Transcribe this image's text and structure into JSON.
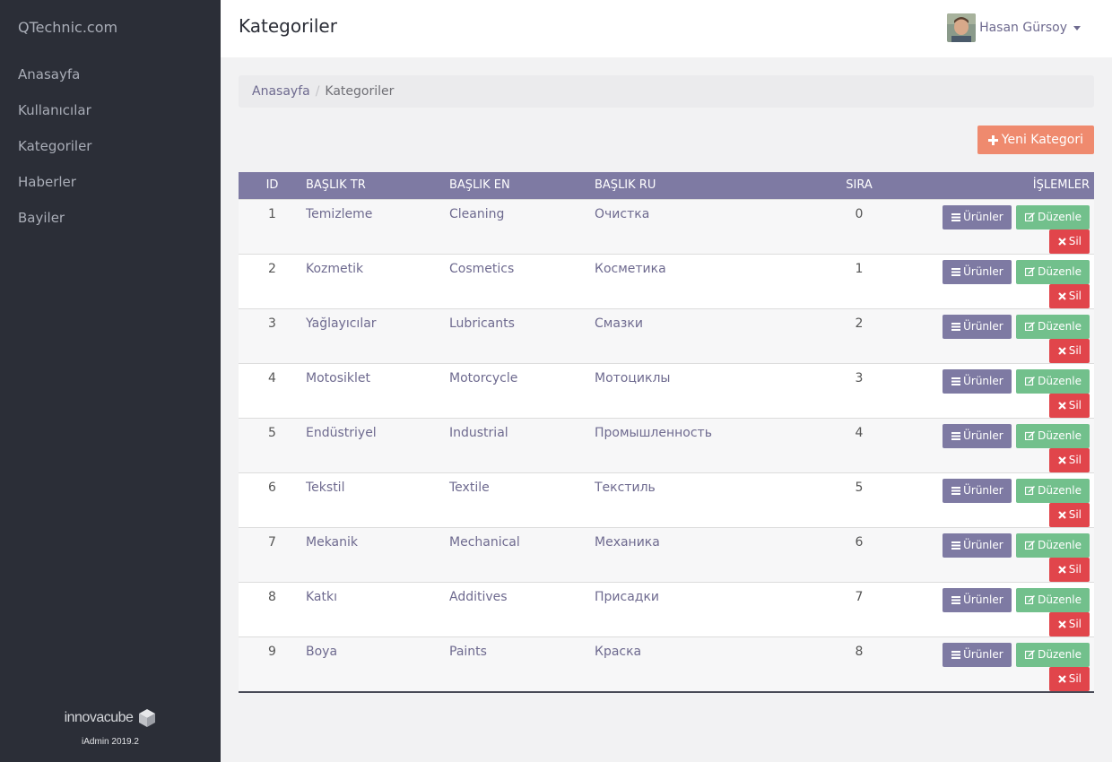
{
  "sidebar": {
    "brand": "QTechnic.com",
    "items": [
      {
        "label": "Anasayfa"
      },
      {
        "label": "Kullanıcılar"
      },
      {
        "label": "Kategoriler"
      },
      {
        "label": "Haberler"
      },
      {
        "label": "Bayiler"
      }
    ],
    "footer": {
      "logo_text": "innovacube",
      "version": "iAdmin 2019.2"
    }
  },
  "header": {
    "title": "Kategoriler",
    "user_name": "Hasan Gürsoy"
  },
  "breadcrumb": {
    "home": "Anasayfa",
    "separator": "/",
    "current": "Kategoriler"
  },
  "actions": {
    "new_category_label": "Yeni Kategori"
  },
  "table": {
    "columns": [
      "ID",
      "BAŞLIK TR",
      "BAŞLIK EN",
      "BAŞLIK RU",
      "SIRA",
      "İŞLEMLER"
    ],
    "row_buttons": {
      "products": "Ürünler",
      "edit": "Düzenle",
      "delete": "Sil"
    },
    "rows": [
      {
        "id": "1",
        "tr": "Temizleme",
        "en": "Cleaning",
        "ru": "Очистка",
        "sira": "0"
      },
      {
        "id": "2",
        "tr": "Kozmetik",
        "en": "Cosmetics",
        "ru": "Косметика",
        "sira": "1"
      },
      {
        "id": "3",
        "tr": "Yağlayıcılar",
        "en": "Lubricants",
        "ru": "Смазки",
        "sira": "2"
      },
      {
        "id": "4",
        "tr": "Motosiklet",
        "en": "Motorcycle",
        "ru": "Мотоциклы",
        "sira": "3"
      },
      {
        "id": "5",
        "tr": "Endüstriyel",
        "en": "Industrial",
        "ru": "Промышленность",
        "sira": "4"
      },
      {
        "id": "6",
        "tr": "Tekstil",
        "en": "Textile",
        "ru": "Текстиль",
        "sira": "5"
      },
      {
        "id": "7",
        "tr": "Mekanik",
        "en": "Mechanical",
        "ru": "Механика",
        "sira": "6"
      },
      {
        "id": "8",
        "tr": "Katkı",
        "en": "Additives",
        "ru": "Присадки",
        "sira": "7"
      },
      {
        "id": "9",
        "tr": "Boya",
        "en": "Paints",
        "ru": "Краска",
        "sira": "8"
      }
    ]
  },
  "icons": {
    "plus": "plus-icon",
    "list": "list-icon",
    "edit": "edit-icon",
    "delete": "times-icon",
    "caret": "caret-down-icon"
  },
  "colors": {
    "sidebar_bg": "#2b2e37",
    "accent_purple": "#7e7aa3",
    "edit_green": "#72c08c",
    "delete_red": "#e1454b",
    "new_orange": "#ef8a6e"
  }
}
